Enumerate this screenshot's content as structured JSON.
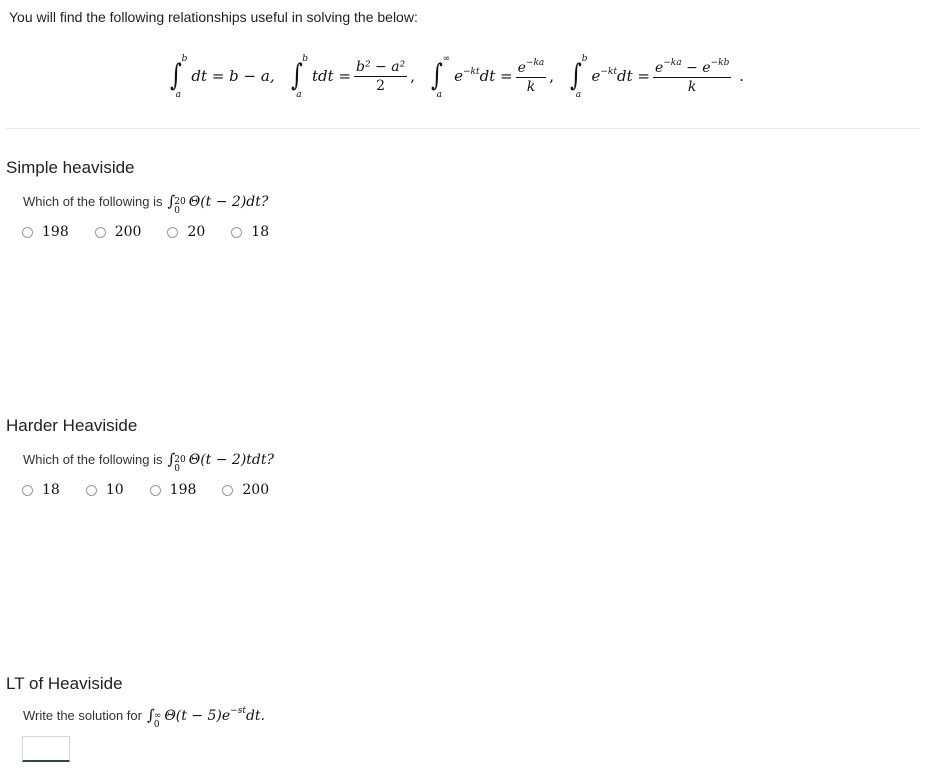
{
  "intro": "You will find the following relationships useful in solving the below:",
  "formulas": [
    {
      "lower": "a",
      "upper": "b",
      "integrand": "dt",
      "rhs": "= b − a,"
    },
    {
      "lower": "a",
      "upper": "b",
      "integrand": "tdt",
      "rhs_num": "b² − a²",
      "rhs_den": "2"
    },
    {
      "lower": "a",
      "upper": "∞",
      "integrand_base": "e",
      "integrand_exp": "−kt",
      "integrand_tail": "dt",
      "rhs_num_base": "e",
      "rhs_num_exp": "−ka",
      "rhs_den": "k"
    },
    {
      "lower": "a",
      "upper": "b",
      "integrand_base": "e",
      "integrand_exp": "−kt",
      "integrand_tail": "dt",
      "rhs_num_a_base": "e",
      "rhs_num_a_exp": "−ka",
      "rhs_num_minus": "−",
      "rhs_num_b_base": "e",
      "rhs_num_b_exp": "−kb",
      "rhs_den": "k"
    }
  ],
  "sections": [
    {
      "title": "Simple heaviside",
      "prompt": "Which of the following is",
      "math": {
        "lower": "0",
        "upper": "20",
        "body": "Θ(t − 2)dt?"
      },
      "options": [
        "198",
        "200",
        "20",
        "18"
      ]
    },
    {
      "title": "Harder Heaviside",
      "prompt": "Which of the following is",
      "math": {
        "lower": "0",
        "upper": "20",
        "body": "Θ(t − 2)tdt?"
      },
      "options": [
        "18",
        "10",
        "198",
        "200"
      ]
    },
    {
      "title": "LT of Heaviside",
      "prompt": "Write the solution for",
      "math": {
        "lower": "0",
        "upper": "∞",
        "body_pre": "Θ(t − 5)e",
        "body_exp": "−st",
        "body_post": "dt."
      },
      "answer_value": ""
    }
  ]
}
